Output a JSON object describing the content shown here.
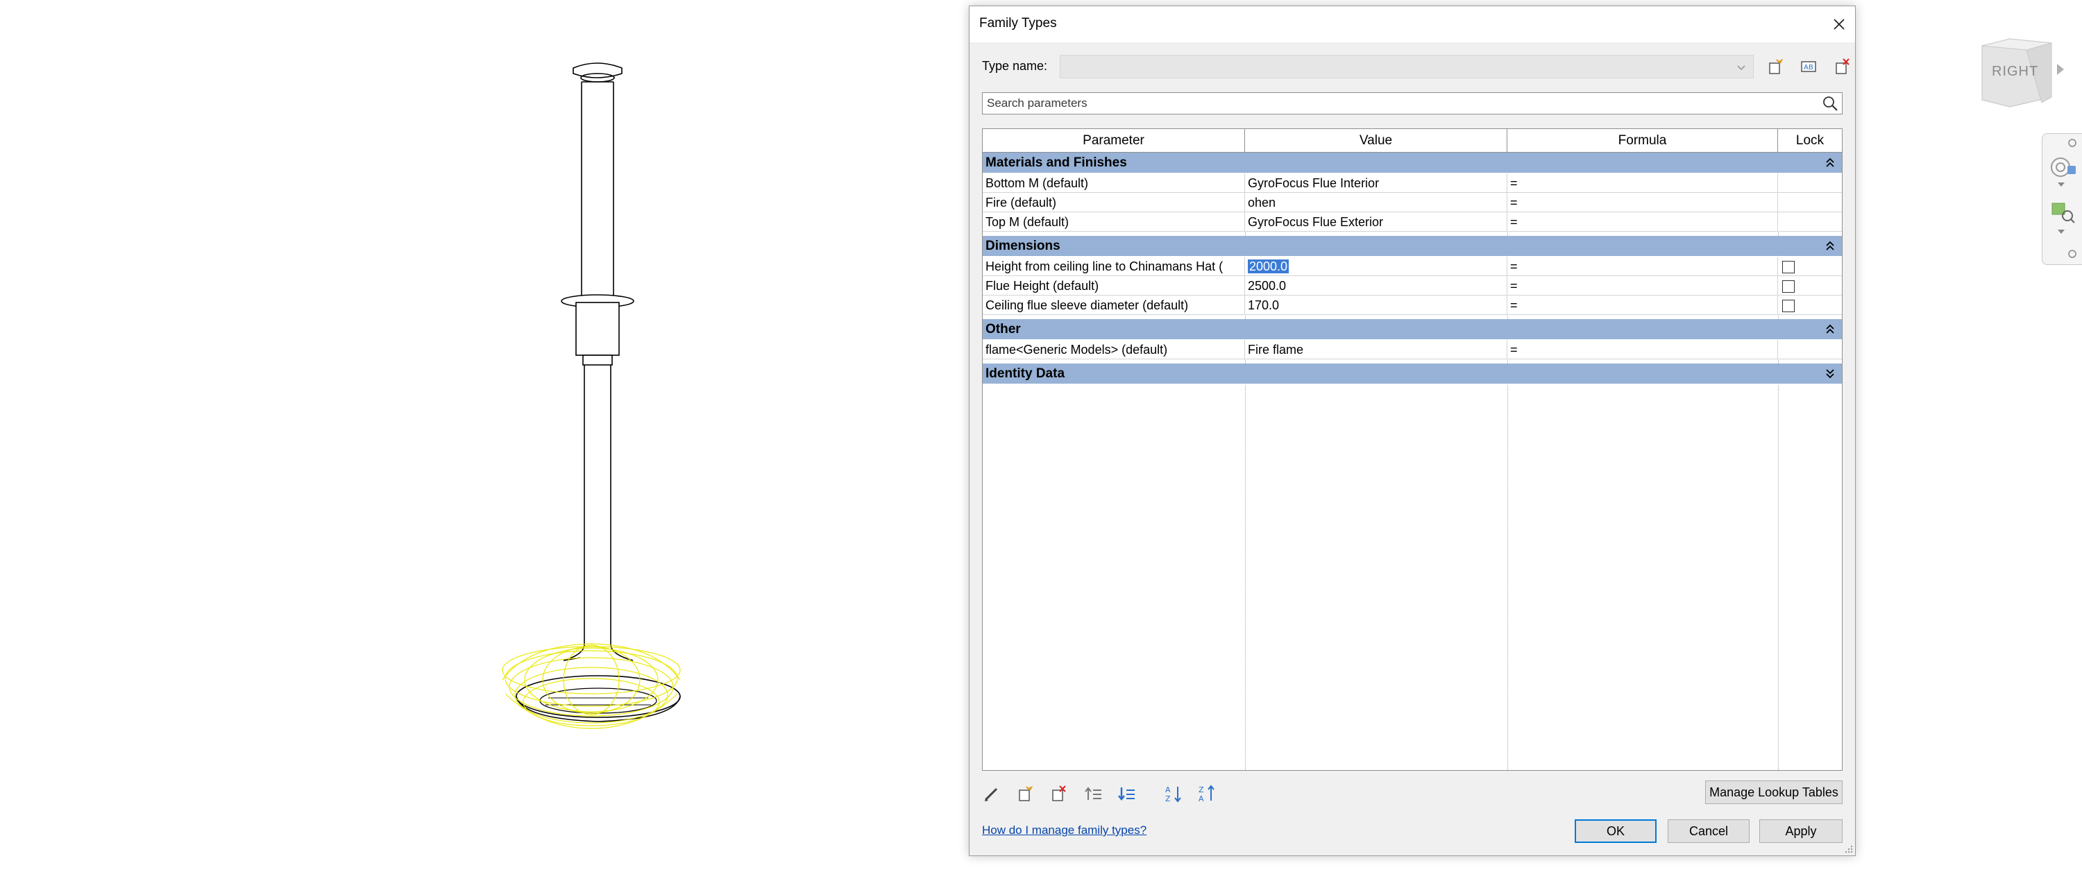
{
  "dialog": {
    "title": "Family Types",
    "type_name_label": "Type name:",
    "type_name_value": "",
    "search_placeholder": "Search parameters",
    "columns": {
      "parameter": "Parameter",
      "value": "Value",
      "formula": "Formula",
      "lock": "Lock"
    },
    "groups": [
      {
        "name": "Materials and Finishes",
        "state": "expanded",
        "rows": [
          {
            "parameter": "Bottom M (default)",
            "value": "GyroFocus Flue Interior",
            "formula": "="
          },
          {
            "parameter": "Fire (default)",
            "value": "ohen",
            "formula": "="
          },
          {
            "parameter": "Top M (default)",
            "value": "GyroFocus Flue Exterior",
            "formula": "="
          }
        ]
      },
      {
        "name": "Dimensions",
        "state": "expanded",
        "rows": [
          {
            "parameter": "Height from ceiling line to Chinamans Hat (",
            "value": "2000.0",
            "formula": "=",
            "lock": false,
            "selected": true
          },
          {
            "parameter": "Flue Height (default)",
            "value": "2500.0",
            "formula": "=",
            "lock": false
          },
          {
            "parameter": "Ceiling flue sleeve diameter (default)",
            "value": "170.0",
            "formula": "=",
            "lock": false
          }
        ]
      },
      {
        "name": "Other",
        "state": "expanded",
        "rows": [
          {
            "parameter": "flame<Generic Models> (default)",
            "value": "Fire flame",
            "formula": "="
          }
        ]
      },
      {
        "name": "Identity Data",
        "state": "collapsed",
        "rows": []
      }
    ],
    "manage_lookup_label": "Manage Lookup Tables",
    "help_link": "How do I manage family types?",
    "ok_label": "OK",
    "cancel_label": "Cancel",
    "apply_label": "Apply",
    "icons": {
      "toolbar_top": [
        "new-type-icon",
        "rename-type-icon",
        "delete-type-icon"
      ],
      "toolbar_bottom": [
        "edit-parameter-icon",
        "new-parameter-icon",
        "delete-parameter-icon",
        "move-up-icon",
        "move-down-icon",
        "sort-ascending-icon",
        "sort-descending-icon"
      ]
    }
  },
  "view_cube": {
    "label": "RIGHT"
  },
  "colors": {
    "group_header": "#97b2d6",
    "selection": "#3b7bd6",
    "flame_wireframe": "#e8e800",
    "link": "#0645ad",
    "ok_border": "#0078d7"
  }
}
